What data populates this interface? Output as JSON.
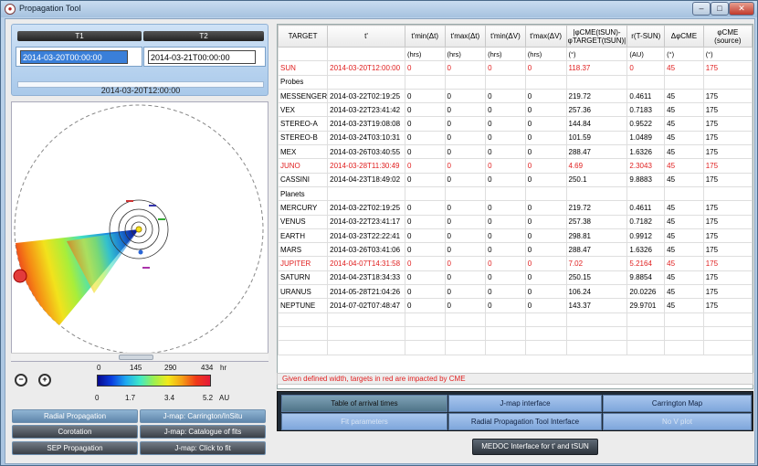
{
  "window": {
    "title": "Propagation Tool"
  },
  "time_panel": {
    "t1_header": "T1",
    "t2_header": "T2",
    "t1_value": "2014-03-20T00:00:00",
    "t2_value": "2014-03-21T00:00:00",
    "selected_time": "2014-03-20T12:00:00"
  },
  "colorbar": {
    "top_ticks": [
      "0",
      "145",
      "290",
      "434"
    ],
    "top_unit": "hr",
    "bottom_ticks": [
      "0",
      "1.7",
      "3.4",
      "5.2"
    ],
    "bottom_unit": "AU"
  },
  "left_buttons": [
    {
      "label": "Radial Propagation",
      "style": "blue"
    },
    {
      "label": "J-map: Carrington/InSitu",
      "style": "blue"
    },
    {
      "label": "Corotation",
      "style": "dark"
    },
    {
      "label": "J-map: Catalogue of fits",
      "style": "dark"
    },
    {
      "label": "SEP Propagation",
      "style": "dark"
    },
    {
      "label": "J-map: Click to fit",
      "style": "dark"
    }
  ],
  "table": {
    "headers": [
      "TARGET",
      "t'",
      "t'min(Δt)",
      "t'max(Δt)",
      "t'min(ΔV)",
      "t'max(ΔV)",
      "|φCME(tSUN)-φTARGET(tSUN)|",
      "r(T-SUN)",
      "ΔφCME",
      "φCME (source)"
    ],
    "units": [
      "",
      "",
      "(hrs)",
      "(hrs)",
      "(hrs)",
      "(hrs)",
      "(°)",
      "(AU)",
      "(°)",
      "(°)"
    ],
    "rows": [
      {
        "type": "red",
        "cells": [
          "SUN",
          "2014-03-20T12:00:00",
          "0",
          "0",
          "0",
          "0",
          "118.37",
          "0",
          "45",
          "175"
        ]
      },
      {
        "type": "section",
        "cells": [
          "Probes",
          "",
          "",
          "",
          "",
          "",
          "",
          "",
          "",
          ""
        ]
      },
      {
        "type": "normal",
        "cells": [
          "MESSENGER",
          "2014-03-22T02:19:25",
          "0",
          "0",
          "0",
          "0",
          "219.72",
          "0.4611",
          "45",
          "175"
        ]
      },
      {
        "type": "normal",
        "cells": [
          "VEX",
          "2014-03-22T23:41:42",
          "0",
          "0",
          "0",
          "0",
          "257.36",
          "0.7183",
          "45",
          "175"
        ]
      },
      {
        "type": "normal",
        "cells": [
          "STEREO-A",
          "2014-03-23T19:08:08",
          "0",
          "0",
          "0",
          "0",
          "144.84",
          "0.9522",
          "45",
          "175"
        ]
      },
      {
        "type": "normal",
        "cells": [
          "STEREO-B",
          "2014-03-24T03:10:31",
          "0",
          "0",
          "0",
          "0",
          "101.59",
          "1.0489",
          "45",
          "175"
        ]
      },
      {
        "type": "normal",
        "cells": [
          "MEX",
          "2014-03-26T03:40:55",
          "0",
          "0",
          "0",
          "0",
          "288.47",
          "1.6326",
          "45",
          "175"
        ]
      },
      {
        "type": "red",
        "cells": [
          "JUNO",
          "2014-03-28T11:30:49",
          "0",
          "0",
          "0",
          "0",
          "4.69",
          "2.3043",
          "45",
          "175"
        ]
      },
      {
        "type": "normal",
        "cells": [
          "CASSINI",
          "2014-04-23T18:49:02",
          "0",
          "0",
          "0",
          "0",
          "250.1",
          "9.8883",
          "45",
          "175"
        ]
      },
      {
        "type": "section",
        "cells": [
          "Planets",
          "",
          "",
          "",
          "",
          "",
          "",
          "",
          "",
          ""
        ]
      },
      {
        "type": "normal",
        "cells": [
          "MERCURY",
          "2014-03-22T02:19:25",
          "0",
          "0",
          "0",
          "0",
          "219.72",
          "0.4611",
          "45",
          "175"
        ]
      },
      {
        "type": "normal",
        "cells": [
          "VENUS",
          "2014-03-22T23:41:17",
          "0",
          "0",
          "0",
          "0",
          "257.38",
          "0.7182",
          "45",
          "175"
        ]
      },
      {
        "type": "normal",
        "cells": [
          "EARTH",
          "2014-03-23T22:22:41",
          "0",
          "0",
          "0",
          "0",
          "298.81",
          "0.9912",
          "45",
          "175"
        ]
      },
      {
        "type": "normal",
        "cells": [
          "MARS",
          "2014-03-26T03:41:06",
          "0",
          "0",
          "0",
          "0",
          "288.47",
          "1.6326",
          "45",
          "175"
        ]
      },
      {
        "type": "red",
        "cells": [
          "JUPITER",
          "2014-04-07T14:31:58",
          "0",
          "0",
          "0",
          "0",
          "7.02",
          "5.2164",
          "45",
          "175"
        ]
      },
      {
        "type": "normal",
        "cells": [
          "SATURN",
          "2014-04-23T18:34:33",
          "0",
          "0",
          "0",
          "0",
          "250.15",
          "9.8854",
          "45",
          "175"
        ]
      },
      {
        "type": "normal",
        "cells": [
          "URANUS",
          "2014-05-28T21:04:26",
          "0",
          "0",
          "0",
          "0",
          "106.24",
          "20.0226",
          "45",
          "175"
        ]
      },
      {
        "type": "normal",
        "cells": [
          "NEPTUNE",
          "2014-07-02T07:48:47",
          "0",
          "0",
          "0",
          "0",
          "143.37",
          "29.9701",
          "45",
          "175"
        ]
      }
    ],
    "empty_rows": 3,
    "footer": "Given defined width, targets in red are impacted by CME"
  },
  "right_buttons": [
    {
      "label": "Table of arrival times",
      "state": "selected"
    },
    {
      "label": "J-map interface",
      "state": "normal"
    },
    {
      "label": "Carrington Map",
      "state": "normal"
    },
    {
      "label": "Fit parameters",
      "state": "disabled"
    },
    {
      "label": "Radial Propagation Tool Interface",
      "state": "normal"
    },
    {
      "label": "No V plot",
      "state": "disabled"
    }
  ],
  "medoc_button": "MEDOC Interface for t' and tSUN",
  "colors": {
    "impacted": "#e02020",
    "accent": "#7ea6db"
  }
}
